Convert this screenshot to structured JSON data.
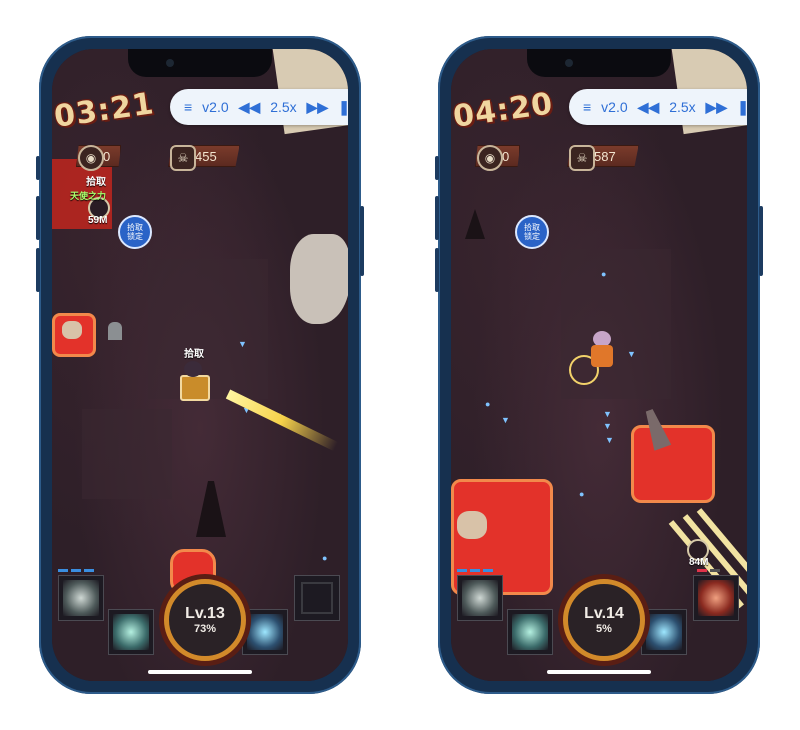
{
  "phones": [
    {
      "timer": "03:21",
      "speed": {
        "version": "v2.0",
        "rate": "2.5x"
      },
      "coins": "0",
      "kills": "455",
      "bubble_text": "拾取\n锁定",
      "pickup_label": "拾取",
      "pickup_label_2": "拾取",
      "enemy_hint": "天使之力",
      "distance": "59M",
      "level": "Lv.13",
      "percent": "73%"
    },
    {
      "timer": "04:20",
      "speed": {
        "version": "v2.0",
        "rate": "2.5x"
      },
      "coins": "0",
      "kills": "587",
      "bubble_text": "拾取\n锁定",
      "distance": "84M",
      "level": "Lv.14",
      "percent": "5%"
    }
  ],
  "colors": {
    "accent": "#2f6fd6",
    "lava": "#e3322a",
    "ring": "#d28a2a"
  }
}
